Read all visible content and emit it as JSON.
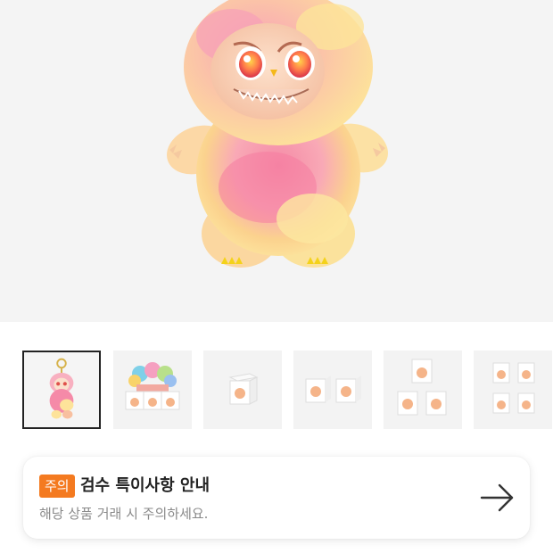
{
  "main_image": {
    "icon": "pink-yellow-fluffy-monster-figure"
  },
  "thumbnails": [
    {
      "icon": "keychain-figure",
      "selected": true
    },
    {
      "icon": "box-set-display",
      "selected": false
    },
    {
      "icon": "single-box",
      "selected": false
    },
    {
      "icon": "two-boxes",
      "selected": false
    },
    {
      "icon": "three-boxes",
      "selected": false
    },
    {
      "icon": "four-boxes",
      "selected": false
    }
  ],
  "notice": {
    "badge": "주의",
    "title": "검수 특이사항 안내",
    "description": "해당 상품 거래 시 주의하세요.",
    "arrow_icon": "arrow-right-icon"
  },
  "colors": {
    "badge": "#f47a20",
    "title": "#222222",
    "description": "#8a8a8a",
    "hero_bg": "#f4f4f4"
  }
}
